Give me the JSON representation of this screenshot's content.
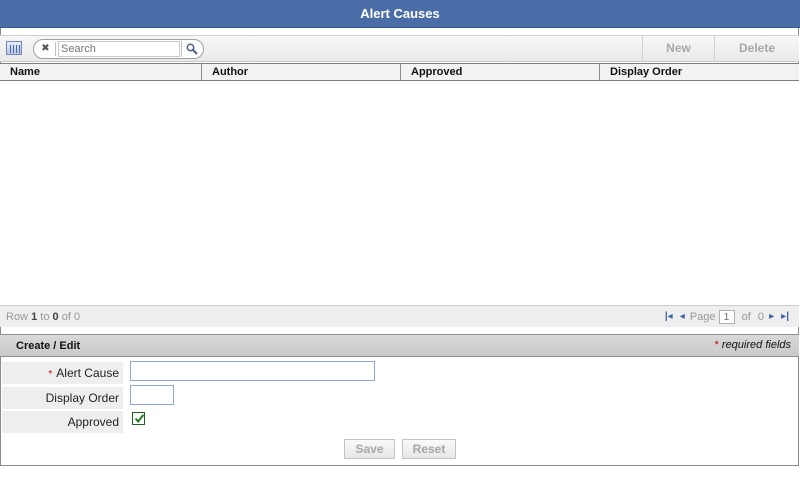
{
  "title": "Alert Causes",
  "toolbar": {
    "columns_icon": "column-chooser-icon",
    "search": {
      "clear_glyph": "✖",
      "placeholder": "Search",
      "value": "Search",
      "button_icon": "magnifier-icon"
    },
    "new_label": "New",
    "delete_label": "Delete"
  },
  "grid": {
    "columns": [
      "Name",
      "Author",
      "Approved",
      "Display Order"
    ],
    "rows": []
  },
  "pager": {
    "row_word": "Row",
    "from": "1",
    "to_word": "to",
    "to": "0",
    "of_word": "of",
    "total": "0",
    "page_word": "Page",
    "page": "1",
    "page_of_word": "of",
    "page_total": "0",
    "first_glyph": "|◂",
    "prev_glyph": "◂",
    "next_glyph": "▸",
    "last_glyph": "▸|"
  },
  "form": {
    "section_title": "Create / Edit",
    "required_star": "*",
    "required_note": "required fields",
    "fields": {
      "alert_cause": {
        "label": "Alert Cause",
        "value": ""
      },
      "display_order": {
        "label": "Display Order",
        "value": ""
      },
      "approved": {
        "label": "Approved",
        "checked": true
      }
    },
    "save_label": "Save",
    "reset_label": "Reset"
  },
  "colors": {
    "title_bar": "#4a6da7",
    "disabled_text": "#a8a8a8",
    "required": "#cc0000",
    "nav_blue": "#3d5fa8"
  }
}
